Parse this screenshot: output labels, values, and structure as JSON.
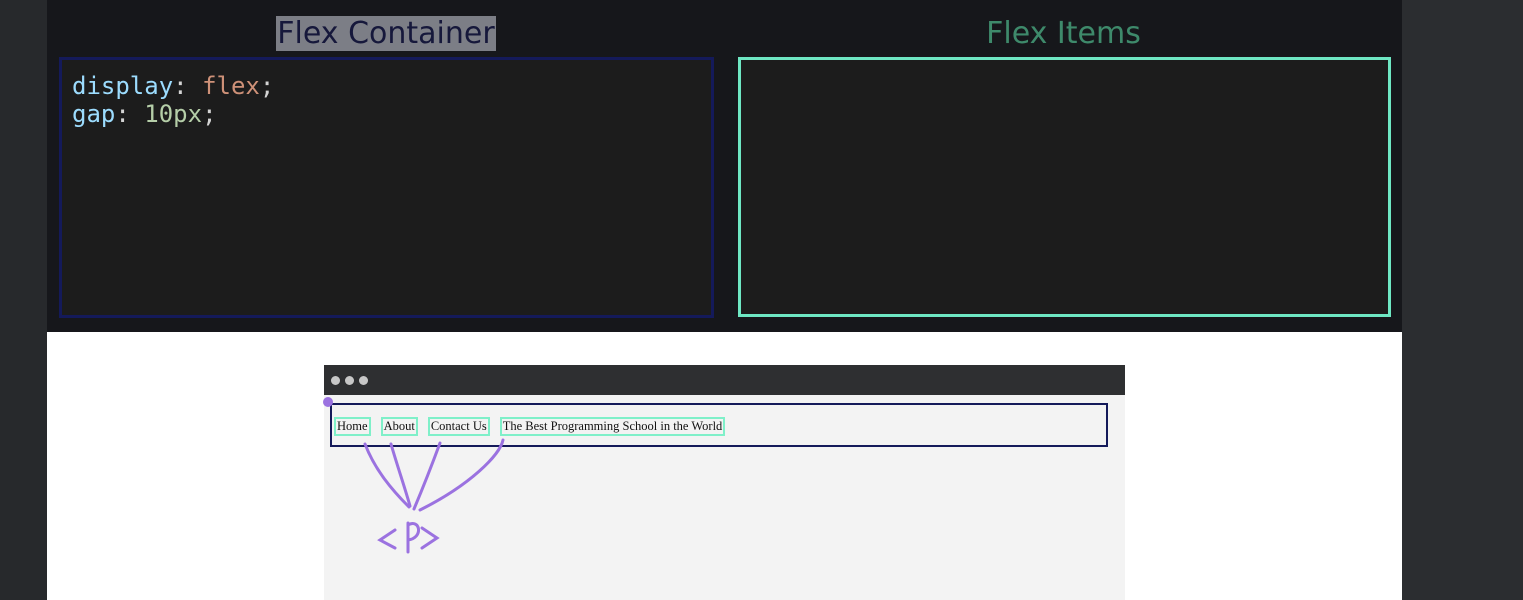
{
  "panels": {
    "container_title": "Flex Container",
    "items_title": "Flex Items"
  },
  "css_code": {
    "line1_prop": "display",
    "line1_value": "flex",
    "line2_prop": "gap",
    "line2_value": "10px"
  },
  "preview": {
    "nav_items": [
      "Home",
      "About",
      "Contact Us",
      "The Best Programming School in the World"
    ],
    "annotation": "<p>"
  },
  "colors": {
    "container_border": "#141a5a",
    "items_border": "#6ee7c3",
    "annotation": "#9b72e0"
  }
}
